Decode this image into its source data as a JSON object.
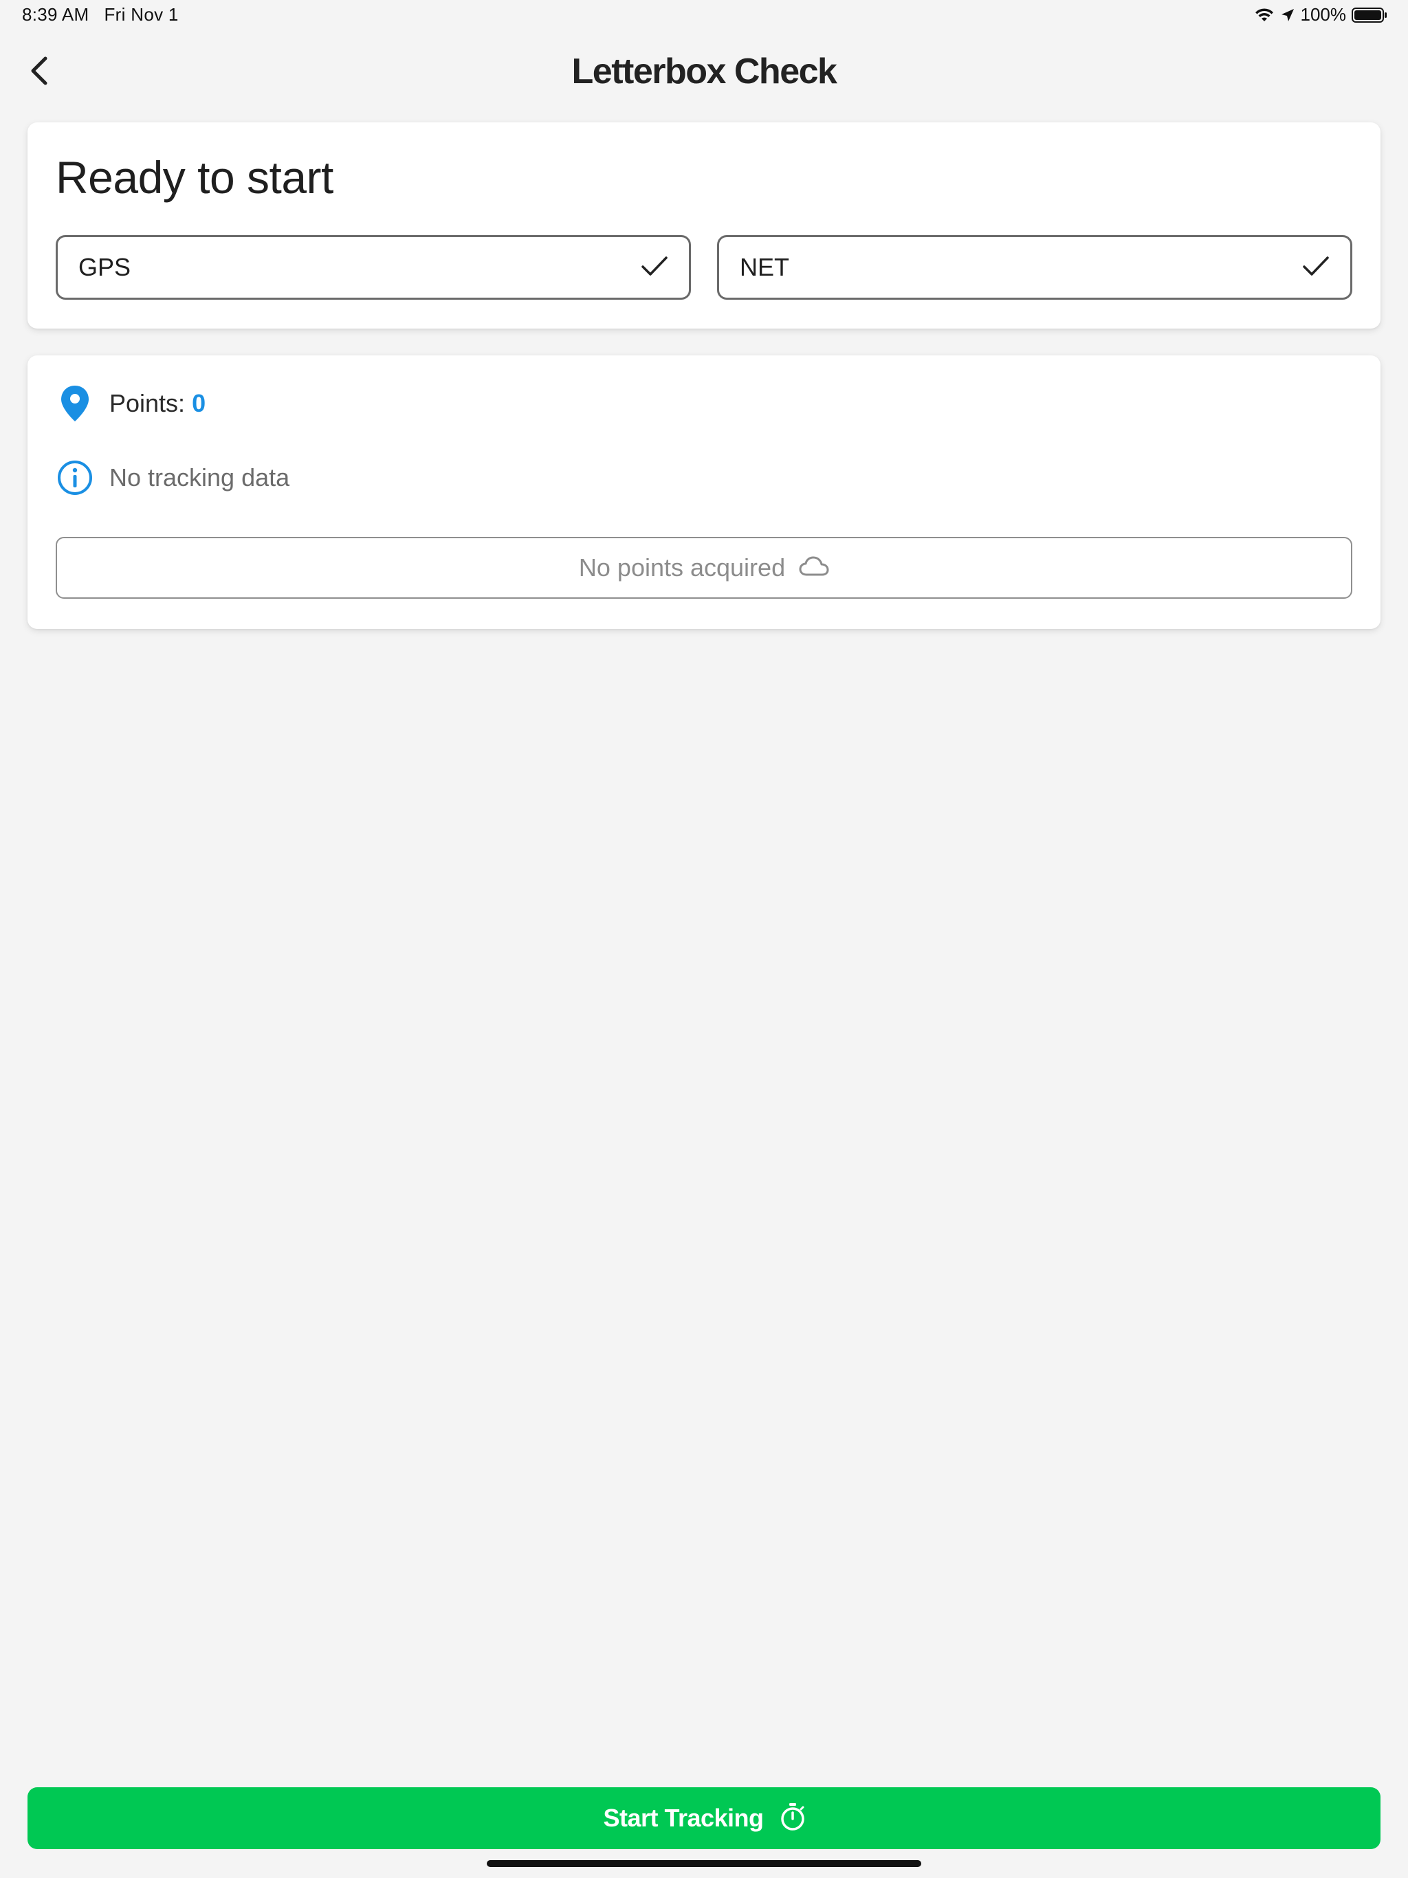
{
  "status_bar": {
    "time": "8:39 AM",
    "date": "Fri Nov 1",
    "battery": "100%",
    "icons": [
      "wifi-icon",
      "location-arrow-icon",
      "battery-icon"
    ]
  },
  "header": {
    "title": "Letterbox Check",
    "back_icon": "chevron-left-icon"
  },
  "status_card": {
    "heading": "Ready to start",
    "toggles": [
      {
        "label": "GPS",
        "checked": true,
        "icon": "checkmark-icon"
      },
      {
        "label": "NET",
        "checked": true,
        "icon": "checkmark-icon"
      }
    ]
  },
  "tracking_card": {
    "points_label": "Points:",
    "points_value": "0",
    "points_icon": "map-pin-icon",
    "no_data_text": "No tracking data",
    "no_data_icon": "info-circle-icon",
    "acquired_text": "No points acquired",
    "acquired_icon": "cloud-icon"
  },
  "footer": {
    "start_label": "Start Tracking",
    "start_icon": "stopwatch-icon"
  },
  "colors": {
    "accent_blue": "#1a8fe3",
    "start_green": "#00c853",
    "background": "#f4f4f4"
  }
}
